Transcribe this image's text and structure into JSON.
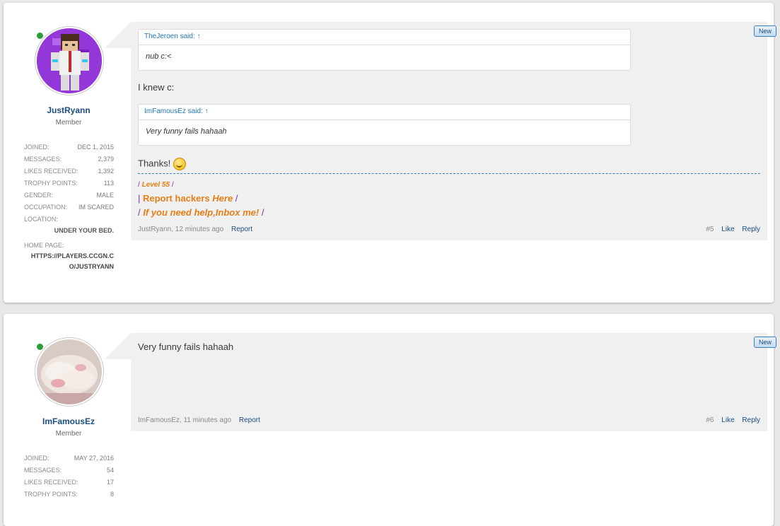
{
  "posts": [
    {
      "author": "JustRyann",
      "user_title": "Member",
      "stats": {
        "joined_label": "JOINED:",
        "joined": "DEC 1, 2015",
        "messages_label": "MESSAGES:",
        "messages": "2,379",
        "likes_label": "LIKES RECEIVED:",
        "likes": "1,392",
        "trophy_label": "TROPHY POINTS:",
        "trophy": "113",
        "gender_label": "GENDER:",
        "gender": "MALE",
        "occupation_label": "OCCUPATION:",
        "occupation": "IM SCARED",
        "location_label": "LOCATION:",
        "location": "UNDER YOUR BED.",
        "homepage_label": "HOME PAGE:",
        "homepage_line1": "HTTPS://PLAYERS.CCGN.C",
        "homepage_line2": "O/JUSTRYANN"
      },
      "quotes": [
        {
          "header": "TheJeroen said: ↑",
          "body": "nub c:<"
        },
        {
          "header": "ImFamousEz said: ↑",
          "body": "Very funny fails hahaah"
        }
      ],
      "text1": "I knew c:",
      "text2": "Thanks!",
      "signature": {
        "line1_slash": "/ ",
        "line1_level": "Level 55",
        "line1_end": " /",
        "line2_start": "| ",
        "line2_report": "Report hackers ",
        "line2_here": "Here",
        "line2_end": " /",
        "line3_start": "/ ",
        "line3_help": "If you need help,Inbox me!",
        "line3_end": " /"
      },
      "footer": {
        "meta": "JustRyann, 12 minutes ago",
        "report": "Report",
        "num": "#5",
        "like": "Like",
        "reply": "Reply"
      },
      "badge": "New"
    },
    {
      "author": "ImFamousEz",
      "user_title": "Member",
      "stats": {
        "joined_label": "JOINED:",
        "joined": "MAY 27, 2016",
        "messages_label": "MESSAGES:",
        "messages": "54",
        "likes_label": "LIKES RECEIVED:",
        "likes": "17",
        "trophy_label": "TROPHY POINTS:",
        "trophy": "8"
      },
      "text1": "Very funny fails hahaah",
      "footer": {
        "meta": "ImFamousEz, 11 minutes ago",
        "report": "Report",
        "num": "#6",
        "like": "Like",
        "reply": "Reply"
      },
      "badge": "New"
    }
  ],
  "colors": {
    "link": "#1a4d7e",
    "accent_orange": "#e67e16",
    "online": "#2a9d38"
  },
  "icons": [
    "online-status-icon",
    "smiley-icon",
    "quote-up-arrow-icon"
  ]
}
